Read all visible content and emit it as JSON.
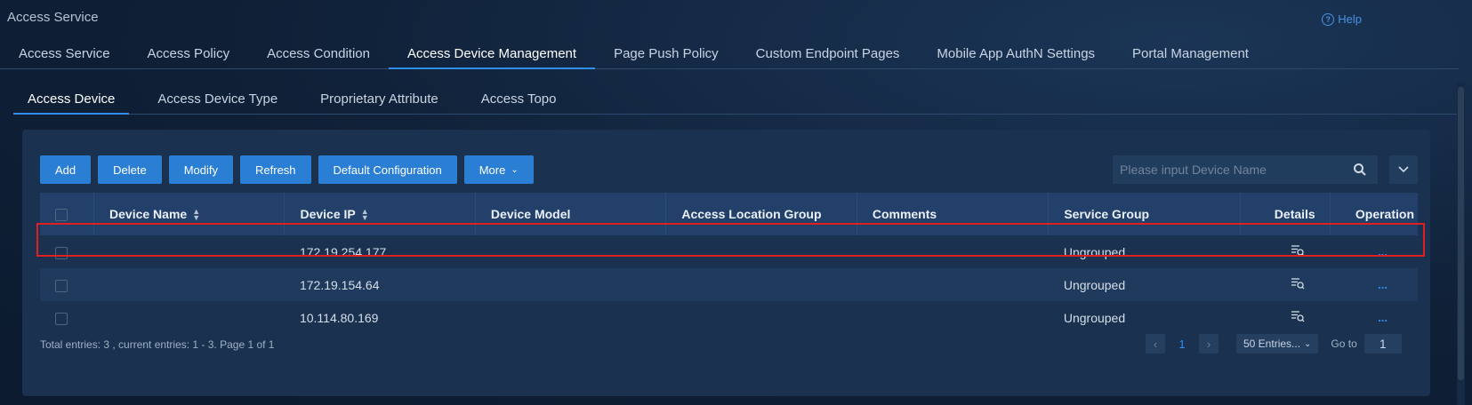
{
  "app": {
    "title": "Access Service",
    "help_label": "Help"
  },
  "main_tabs": [
    {
      "label": "Access Service"
    },
    {
      "label": "Access Policy"
    },
    {
      "label": "Access Condition"
    },
    {
      "label": "Access Device Management",
      "active": true
    },
    {
      "label": "Page Push Policy"
    },
    {
      "label": "Custom Endpoint Pages"
    },
    {
      "label": "Mobile App AuthN Settings"
    },
    {
      "label": "Portal Management"
    }
  ],
  "sub_tabs": [
    {
      "label": "Access Device",
      "active": true
    },
    {
      "label": "Access Device Type"
    },
    {
      "label": "Proprietary Attribute"
    },
    {
      "label": "Access Topo"
    }
  ],
  "toolbar": {
    "add": "Add",
    "delete": "Delete",
    "modify": "Modify",
    "refresh": "Refresh",
    "default_config": "Default Configuration",
    "more": "More"
  },
  "search": {
    "placeholder": "Please input Device Name"
  },
  "table": {
    "columns": [
      "Device Name",
      "Device IP",
      "Device Model",
      "Access Location Group",
      "Comments",
      "Service Group",
      "Details",
      "Operation"
    ],
    "rows": [
      {
        "device_name": "",
        "device_ip": "172.19.254.177",
        "device_model": "",
        "location_group": "",
        "comments": "",
        "service_group": "Ungrouped",
        "operation": "..."
      },
      {
        "device_name": "",
        "device_ip": "172.19.154.64",
        "device_model": "",
        "location_group": "",
        "comments": "",
        "service_group": "Ungrouped",
        "operation": "..."
      },
      {
        "device_name": "",
        "device_ip": "10.114.80.169",
        "device_model": "",
        "location_group": "",
        "comments": "",
        "service_group": "Ungrouped",
        "operation": "..."
      }
    ]
  },
  "footer": {
    "summary": "Total entries: 3 , current entries: 1 - 3. Page 1 of 1",
    "page": "1",
    "page_size": "50 Entries...",
    "goto_label": "Go to",
    "goto_value": "1"
  },
  "colors": {
    "accent": "#2f8ef0",
    "button": "#2a7fd4",
    "highlight": "#e02020",
    "background": "#0f2037"
  }
}
